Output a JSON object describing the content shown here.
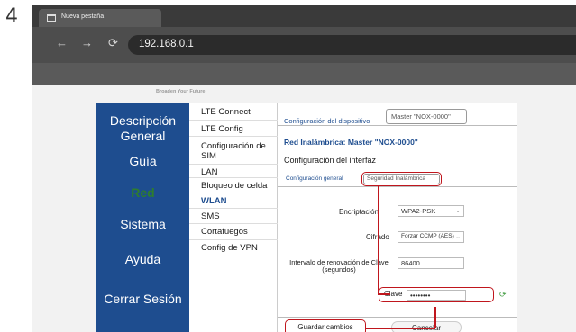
{
  "step": "4",
  "browser": {
    "tab_title": "Nueva pestaña",
    "address": "192.168.0.1"
  },
  "site": {
    "tagline": "Broaden Your Future"
  },
  "leftnav": [
    {
      "label": "Descripción General",
      "active": false
    },
    {
      "label": "Guía",
      "active": false
    },
    {
      "label": "Red",
      "active": true
    },
    {
      "label": "Sistema",
      "active": false
    },
    {
      "label": "Ayuda",
      "active": false
    },
    {
      "label": "Cerrar Sesión",
      "active": false
    }
  ],
  "submenu": [
    {
      "label": "LTE Connect",
      "active": false
    },
    {
      "label": "LTE Config",
      "active": false
    },
    {
      "label": "Configuración de SIM",
      "active": false
    },
    {
      "label": "LAN",
      "active": false
    },
    {
      "label": "Bloqueo de celda",
      "active": false
    },
    {
      "label": "WLAN",
      "active": true
    },
    {
      "label": "SMS",
      "active": false
    },
    {
      "label": "Cortafuegos",
      "active": false
    },
    {
      "label": "Config de VPN",
      "active": false
    }
  ],
  "content": {
    "device_config_link": "Configuración del dispositivo",
    "device_tab": "Master \"NOX-0000\"",
    "network_title": "Red Inalámbrica: Master \"NOX-0000\"",
    "interface_title": "Configuración del interfaz",
    "subtabs": {
      "general": "Configuración general",
      "security": "Seguridad Inalámbrica"
    },
    "form": {
      "encryption_label": "Encriptación",
      "encryption_value": "WPA2-PSK",
      "cipher_label": "Cifrado",
      "cipher_value": "Forzar CCMP (AES)",
      "renewal_label": "Intervalo de renovación de Clave (segundos)",
      "renewal_value": "86400",
      "key_label": "Clave",
      "key_value": "••••••••"
    },
    "buttons": {
      "save": "Guardar cambios",
      "cancel": "Cancelar"
    },
    "highlight_color": "#c0161d"
  }
}
